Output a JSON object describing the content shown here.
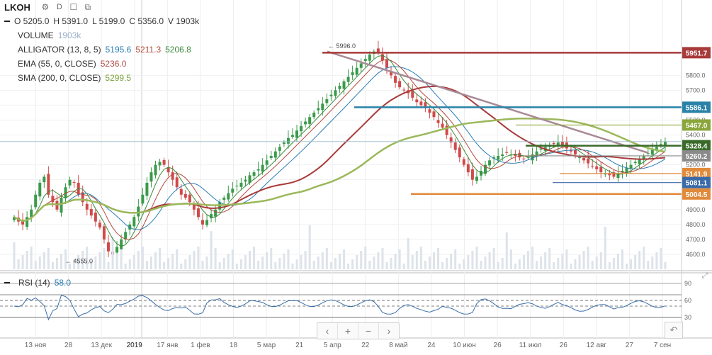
{
  "header": {
    "symbol": "LKOH",
    "interval": "D",
    "ohlc": [
      {
        "k": "O",
        "v": "5205.0"
      },
      {
        "k": "H",
        "v": "5391.0"
      },
      {
        "k": "L",
        "v": "5199.0"
      },
      {
        "k": "C",
        "v": "5356.0"
      },
      {
        "k": "V",
        "v": "1903k"
      }
    ]
  },
  "indicators": [
    {
      "name": "VOLUME",
      "values": [
        {
          "v": "1903k",
          "color": "#9ab0c7"
        }
      ]
    },
    {
      "name": "ALLIGATOR (13, 8, 5)",
      "values": [
        {
          "v": "5195.6",
          "color": "#2a7db5"
        },
        {
          "v": "5211.3",
          "color": "#b34a3a"
        },
        {
          "v": "5206.8",
          "color": "#3a8a3a"
        }
      ]
    },
    {
      "name": "EMA (55, 0, CLOSE)",
      "values": [
        {
          "v": "5236.0",
          "color": "#b0504a"
        }
      ]
    },
    {
      "name": "SMA (200, 0, CLOSE)",
      "values": [
        {
          "v": "5299.5",
          "color": "#7aa13c"
        }
      ]
    }
  ],
  "rsi": {
    "name": "RSI (14)",
    "value": "58.0",
    "levels": [
      "90",
      "60",
      "30"
    ],
    "level_values": [
      90,
      60,
      30
    ]
  },
  "colors": {
    "up": "#3a9a4a",
    "down": "#d04a4a",
    "alligator_jaw": "#2a7db5",
    "alligator_teeth": "#b34a3a",
    "alligator_lips": "#3a8a3a",
    "ema": "#a83a3a",
    "sma": "#9bb85a"
  },
  "annotations": {
    "high": "5996.0",
    "low": "4555.0"
  },
  "price_levels": [
    {
      "label": "5951.7",
      "value": 5951.7,
      "color": "#a83a3a"
    },
    {
      "label": "5586.1",
      "value": 5586.1,
      "color": "#2a82a8"
    },
    {
      "label": "5467.0",
      "value": 5467.0,
      "color": "#8aa63a"
    },
    {
      "label": "5328.4",
      "value": 5328.4,
      "color": "#3a6a2a"
    },
    {
      "label": "5260.2",
      "value": 5260.2,
      "color": "#8a8a8a"
    },
    {
      "label": "5141.9",
      "value": 5141.9,
      "color": "#e08a3a"
    },
    {
      "label": "5081.1",
      "value": 5081.1,
      "color": "#3a6aa8"
    },
    {
      "label": "5004.5",
      "value": 5004.5,
      "color": "#e08a3a"
    }
  ],
  "y_axis": {
    "ticks": [
      "5800.0",
      "5700.0",
      "5600.0",
      "5500.0",
      "5400.0",
      "5200.0",
      "5100.0",
      "4900.0",
      "4800.0",
      "4700.0",
      "4600.0"
    ],
    "tick_values": [
      5800,
      5700,
      5600,
      5500,
      5400,
      5200,
      5100,
      4900,
      4800,
      4700,
      4600
    ]
  },
  "x_axis": {
    "labels": [
      "13 ноя",
      "28",
      "13 дек",
      "2019",
      "17 янв",
      "1 фев",
      "18",
      "5 мар",
      "21",
      "5 апр",
      "22",
      "8 май",
      "24",
      "10 июн",
      "26",
      "11 июл",
      "26",
      "12 авг",
      "27",
      "7 сен"
    ]
  },
  "navigation": {
    "prev": "‹",
    "zoom_in": "+",
    "zoom_out": "−",
    "next": "›",
    "undo": "↶"
  },
  "chart_data": {
    "type": "candlestick",
    "close": [
      4850,
      4820,
      4800,
      4850,
      4900,
      5000,
      5080,
      5120,
      5000,
      4950,
      4900,
      4980,
      5050,
      5100,
      5080,
      5000,
      4950,
      4900,
      4860,
      4820,
      4780,
      4700,
      4620,
      4600,
      4650,
      4700,
      4750,
      4800,
      4850,
      4920,
      5000,
      5080,
      5150,
      5200,
      5220,
      5200,
      5150,
      5100,
      5050,
      5000,
      4980,
      4950,
      4900,
      4850,
      4800,
      4830,
      4870,
      4900,
      4950,
      4980,
      5010,
      5040,
      5060,
      5080,
      5100,
      5130,
      5150,
      5170,
      5200,
      5230,
      5260,
      5290,
      5320,
      5350,
      5380,
      5400,
      5430,
      5460,
      5490,
      5520,
      5550,
      5580,
      5610,
      5640,
      5670,
      5700,
      5730,
      5760,
      5790,
      5820,
      5850,
      5880,
      5910,
      5940,
      5960,
      5950,
      5900,
      5850,
      5800,
      5750,
      5720,
      5700,
      5680,
      5650,
      5620,
      5600,
      5580,
      5550,
      5520,
      5480,
      5450,
      5400,
      5350,
      5300,
      5250,
      5200,
      5150,
      5100,
      5120,
      5160,
      5200,
      5230,
      5250,
      5260,
      5270,
      5280,
      5270,
      5260,
      5250,
      5240,
      5250,
      5270,
      5290,
      5310,
      5320,
      5330,
      5340,
      5350,
      5330,
      5310,
      5290,
      5270,
      5250,
      5230,
      5210,
      5190,
      5170,
      5150,
      5140,
      5130,
      5120,
      5140,
      5160,
      5180,
      5200,
      5220,
      5240,
      5260,
      5280,
      5300,
      5320,
      5340,
      5356
    ],
    "markers": {
      "high": {
        "label": "5996.0",
        "value": 5996.0
      },
      "low": {
        "label": "4555.0",
        "value": 4555.0
      }
    },
    "ylim": [
      4500,
      6020
    ],
    "rsi_ylim": [
      0,
      100
    ]
  }
}
